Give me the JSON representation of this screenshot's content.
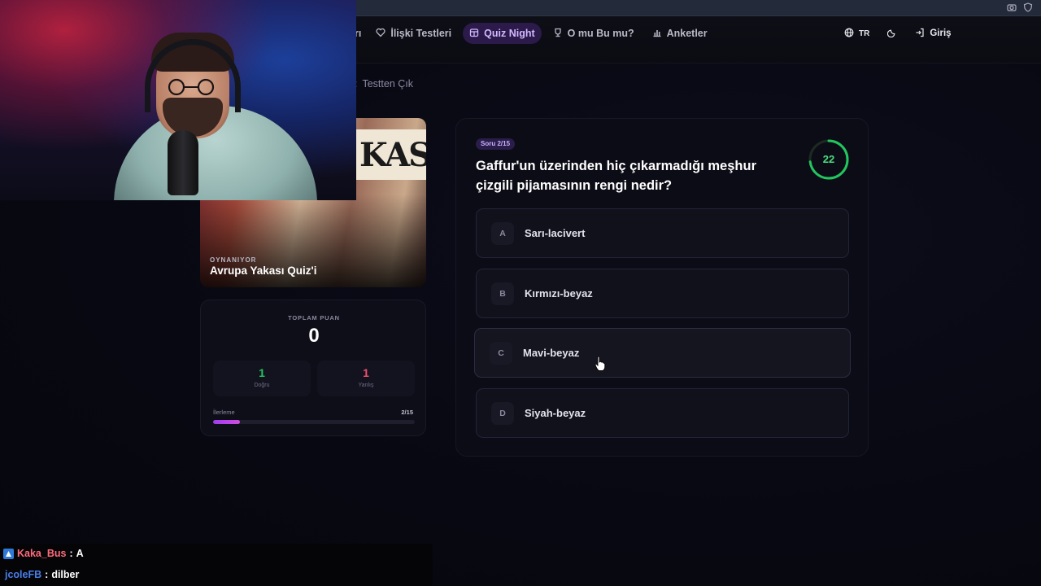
{
  "nav": {
    "partial_item": "rı",
    "items": [
      {
        "label": "İlişki Testleri",
        "icon": "heart-icon",
        "active": false
      },
      {
        "label": "Quiz Night",
        "icon": "calendar-icon",
        "active": true
      },
      {
        "label": "O mu Bu mu?",
        "icon": "trophy-icon",
        "active": false
      },
      {
        "label": "Anketler",
        "icon": "bar-chart-icon",
        "active": false
      }
    ],
    "language": "TR",
    "login": "Giriş"
  },
  "exit_label": "Testten Çık",
  "quiz": {
    "status": "OYNANIYOR",
    "title": "Avrupa Yakası Quiz'i",
    "image_sign": "KAS"
  },
  "score": {
    "label": "TOPLAM PUAN",
    "value": "0",
    "correct": {
      "value": "1",
      "label": "Doğru"
    },
    "wrong": {
      "value": "1",
      "label": "Yanlış"
    },
    "progress_label": "İlerleme",
    "progress_count": "2/15",
    "progress_fraction": 0.133
  },
  "question": {
    "badge": "Soru 2/15",
    "text": "Gaffur'un üzerinden hiç çıkarmadığı meşhur çizgili pijamasının rengi nedir?",
    "timer": "22",
    "timer_fraction": 0.73,
    "options": [
      {
        "letter": "A",
        "text": "Sarı-lacivert"
      },
      {
        "letter": "B",
        "text": "Kırmızı-beyaz"
      },
      {
        "letter": "C",
        "text": "Mavi-beyaz"
      },
      {
        "letter": "D",
        "text": "Siyah-beyaz"
      }
    ]
  },
  "chat": [
    {
      "user": "Kaka_Bus",
      "message": "A"
    },
    {
      "user": "jcoleFB",
      "message": "dilber"
    }
  ],
  "colors": {
    "accent": "#9d3cf0",
    "correct": "#22c55e",
    "wrong": "#f0506e",
    "timer": "#4ade80"
  }
}
